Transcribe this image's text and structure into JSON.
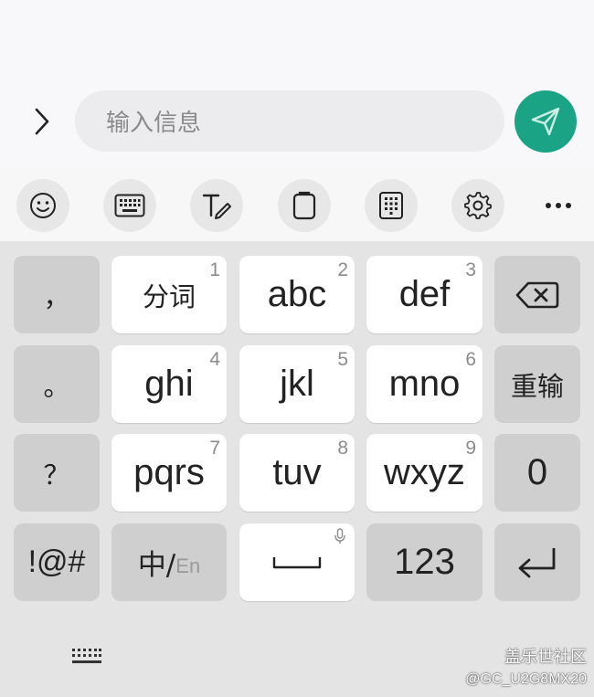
{
  "input": {
    "placeholder": "输入信息"
  },
  "toolbar": {
    "icons": [
      "emoji-icon",
      "keyboard-layout-icon",
      "handwriting-icon",
      "clipboard-icon",
      "number-pad-icon",
      "gear-icon",
      "more-icon"
    ]
  },
  "keys": {
    "comma": "，",
    "fenci": "分词",
    "abc": "abc",
    "def": "def",
    "period": "。",
    "ghi": "ghi",
    "jkl": "jkl",
    "mno": "mno",
    "chongshu": "重输",
    "question": "？",
    "pqrs": "pqrs",
    "tuv": "tuv",
    "wxyz": "wxyz",
    "zero": "0",
    "symbols": "!@#",
    "lang_zh": "中/",
    "lang_en": "En",
    "num_mode": "123"
  },
  "digits": {
    "k1": "1",
    "k2": "2",
    "k3": "3",
    "k4": "4",
    "k5": "5",
    "k6": "6",
    "k7": "7",
    "k8": "8",
    "k9": "9"
  },
  "watermark": {
    "line1": "盖乐世社区",
    "line2": "@GC_U2G8MX20"
  },
  "colors": {
    "send": "#1aa485",
    "key": "#ffffff",
    "fn_key": "#cfcfcf",
    "keyboard_bg": "#e4e4e4"
  }
}
